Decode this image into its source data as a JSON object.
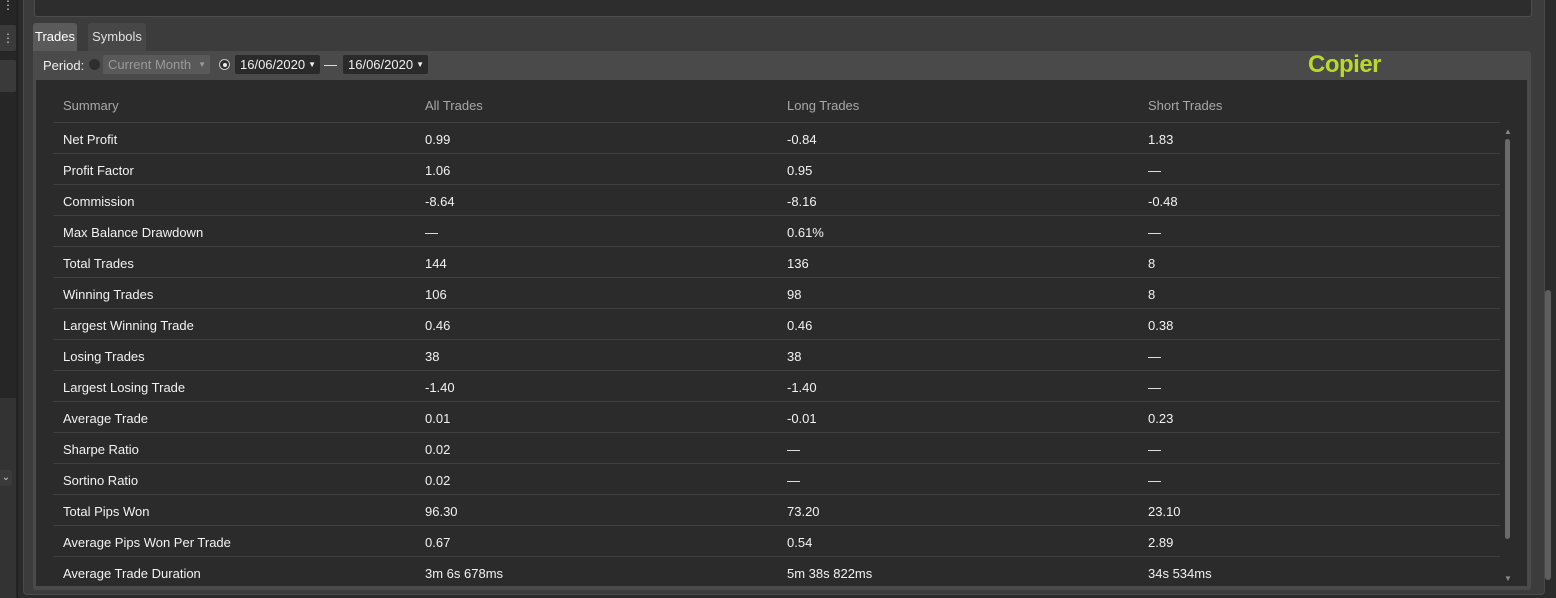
{
  "tabs": [
    {
      "label": "Trades"
    },
    {
      "label": "Symbols"
    }
  ],
  "toolbar": {
    "period_label": "Period:",
    "period_option": "Current Month",
    "date_from": "16/06/2020",
    "separator": "—",
    "date_to": "16/06/2020"
  },
  "brand": {
    "name": "Copier",
    "color": "#b6d92a"
  },
  "table": {
    "headers": [
      "Summary",
      "All Trades",
      "Long Trades",
      "Short Trades"
    ],
    "rows": [
      [
        "Net Profit",
        "0.99",
        "-0.84",
        "1.83"
      ],
      [
        "Profit Factor",
        "1.06",
        "0.95",
        "—"
      ],
      [
        "Commission",
        "-8.64",
        "-8.16",
        "-0.48"
      ],
      [
        "Max Balance Drawdown",
        "—",
        "0.61%",
        "—"
      ],
      [
        "Total Trades",
        "144",
        "136",
        "8"
      ],
      [
        "Winning Trades",
        "106",
        "98",
        "8"
      ],
      [
        "Largest Winning Trade",
        "0.46",
        "0.46",
        "0.38"
      ],
      [
        "Losing Trades",
        "38",
        "38",
        "—"
      ],
      [
        "Largest Losing Trade",
        "-1.40",
        "-1.40",
        "—"
      ],
      [
        "Average Trade",
        "0.01",
        "-0.01",
        "0.23"
      ],
      [
        "Sharpe Ratio",
        "0.02",
        "—",
        "—"
      ],
      [
        "Sortino Ratio",
        "0.02",
        "—",
        "—"
      ],
      [
        "Total Pips Won",
        "96.30",
        "73.20",
        "23.10"
      ],
      [
        "Average Pips Won Per Trade",
        "0.67",
        "0.54",
        "2.89"
      ],
      [
        "Average Trade Duration",
        "3m 6s 678ms",
        "5m 38s 822ms",
        "34s 534ms"
      ]
    ]
  }
}
